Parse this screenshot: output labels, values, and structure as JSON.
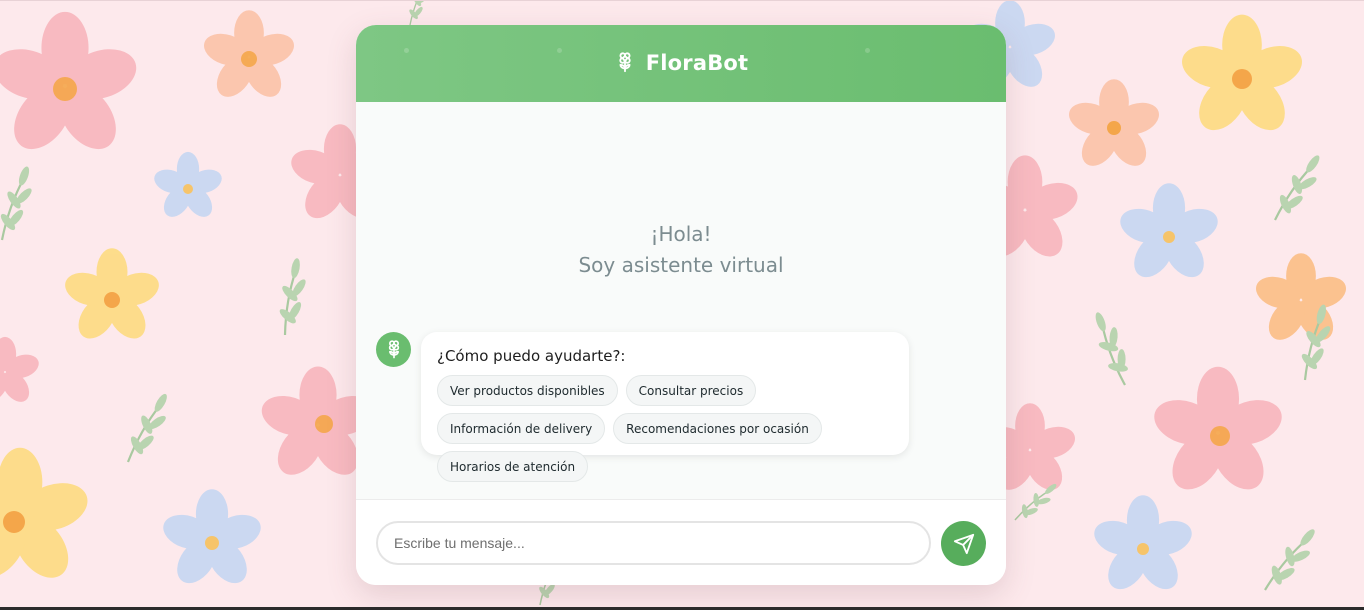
{
  "app": {
    "title": "FloraBot",
    "icon": "flower-icon"
  },
  "welcome": {
    "line1": "¡Hola!",
    "line2": "Soy asistente virtual"
  },
  "bot_message": {
    "avatar_icon": "flower-icon",
    "text": "¿Cómo puedo ayudarte?:",
    "options": [
      "Ver productos disponibles",
      "Consultar precios",
      "Información de delivery",
      "Recomendaciones por ocasión",
      "Horarios de atención"
    ]
  },
  "composer": {
    "placeholder": "Escribe tu mensaje...",
    "send_icon": "send-icon"
  },
  "colors": {
    "page_background": "#fde9ec",
    "header_green": "#6abd6f",
    "send_button": "#57ad5c",
    "welcome_text": "#7c8c90"
  }
}
